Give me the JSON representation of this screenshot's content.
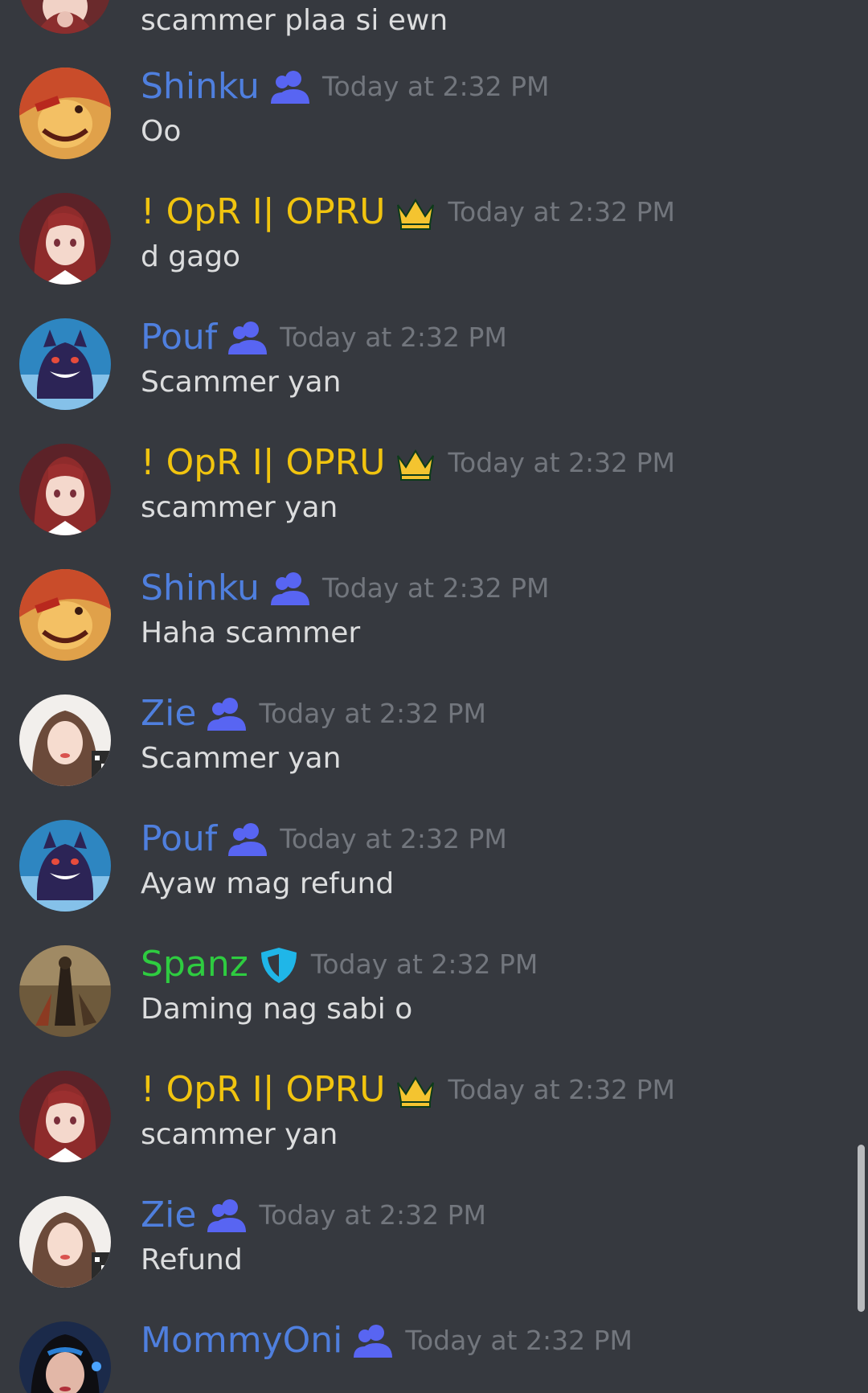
{
  "colors": {
    "background": "#36393f",
    "timestamp": "#72767d",
    "message_text": "#dcddde",
    "role_member": "#4f7fde",
    "role_owner": "#f1c40f",
    "role_moderator": "#2ecc40",
    "member_badge": "#5865f2",
    "shield_badge": "#1fb6e8",
    "crown_badge": "#f4c430"
  },
  "partial_message": {
    "content": "scammer plaa si ewn"
  },
  "messages": [
    {
      "username": "Shinku",
      "badge": "members-icon",
      "timestamp": "Today at 2:32 PM",
      "content": "Oo"
    },
    {
      "username": "! OpR I| OPRU",
      "badge": "crown-icon",
      "timestamp": "Today at 2:32 PM",
      "content": "d gago"
    },
    {
      "username": "Pouf",
      "badge": "members-icon",
      "timestamp": "Today at 2:32 PM",
      "content": "Scammer yan"
    },
    {
      "username": "! OpR I| OPRU",
      "badge": "crown-icon",
      "timestamp": "Today at 2:32 PM",
      "content": "scammer yan"
    },
    {
      "username": "Shinku",
      "badge": "members-icon",
      "timestamp": "Today at 2:32 PM",
      "content": "Haha scammer"
    },
    {
      "username": "Zie",
      "badge": "members-icon",
      "timestamp": "Today at 2:32 PM",
      "content": "Scammer yan"
    },
    {
      "username": "Pouf",
      "badge": "members-icon",
      "timestamp": "Today at 2:32 PM",
      "content": "Ayaw mag refund"
    },
    {
      "username": "Spanz",
      "badge": "shield-icon",
      "timestamp": "Today at 2:32 PM",
      "content": "Daming nag sabi o"
    },
    {
      "username": "! OpR I| OPRU",
      "badge": "crown-icon",
      "timestamp": "Today at 2:32 PM",
      "content": "scammer yan"
    },
    {
      "username": "Zie",
      "badge": "members-icon",
      "timestamp": "Today at 2:32 PM",
      "content": "Refund"
    },
    {
      "username": "MommyOni",
      "badge": "members-icon",
      "timestamp": "Today at 2:32 PM",
      "content": ""
    }
  ]
}
